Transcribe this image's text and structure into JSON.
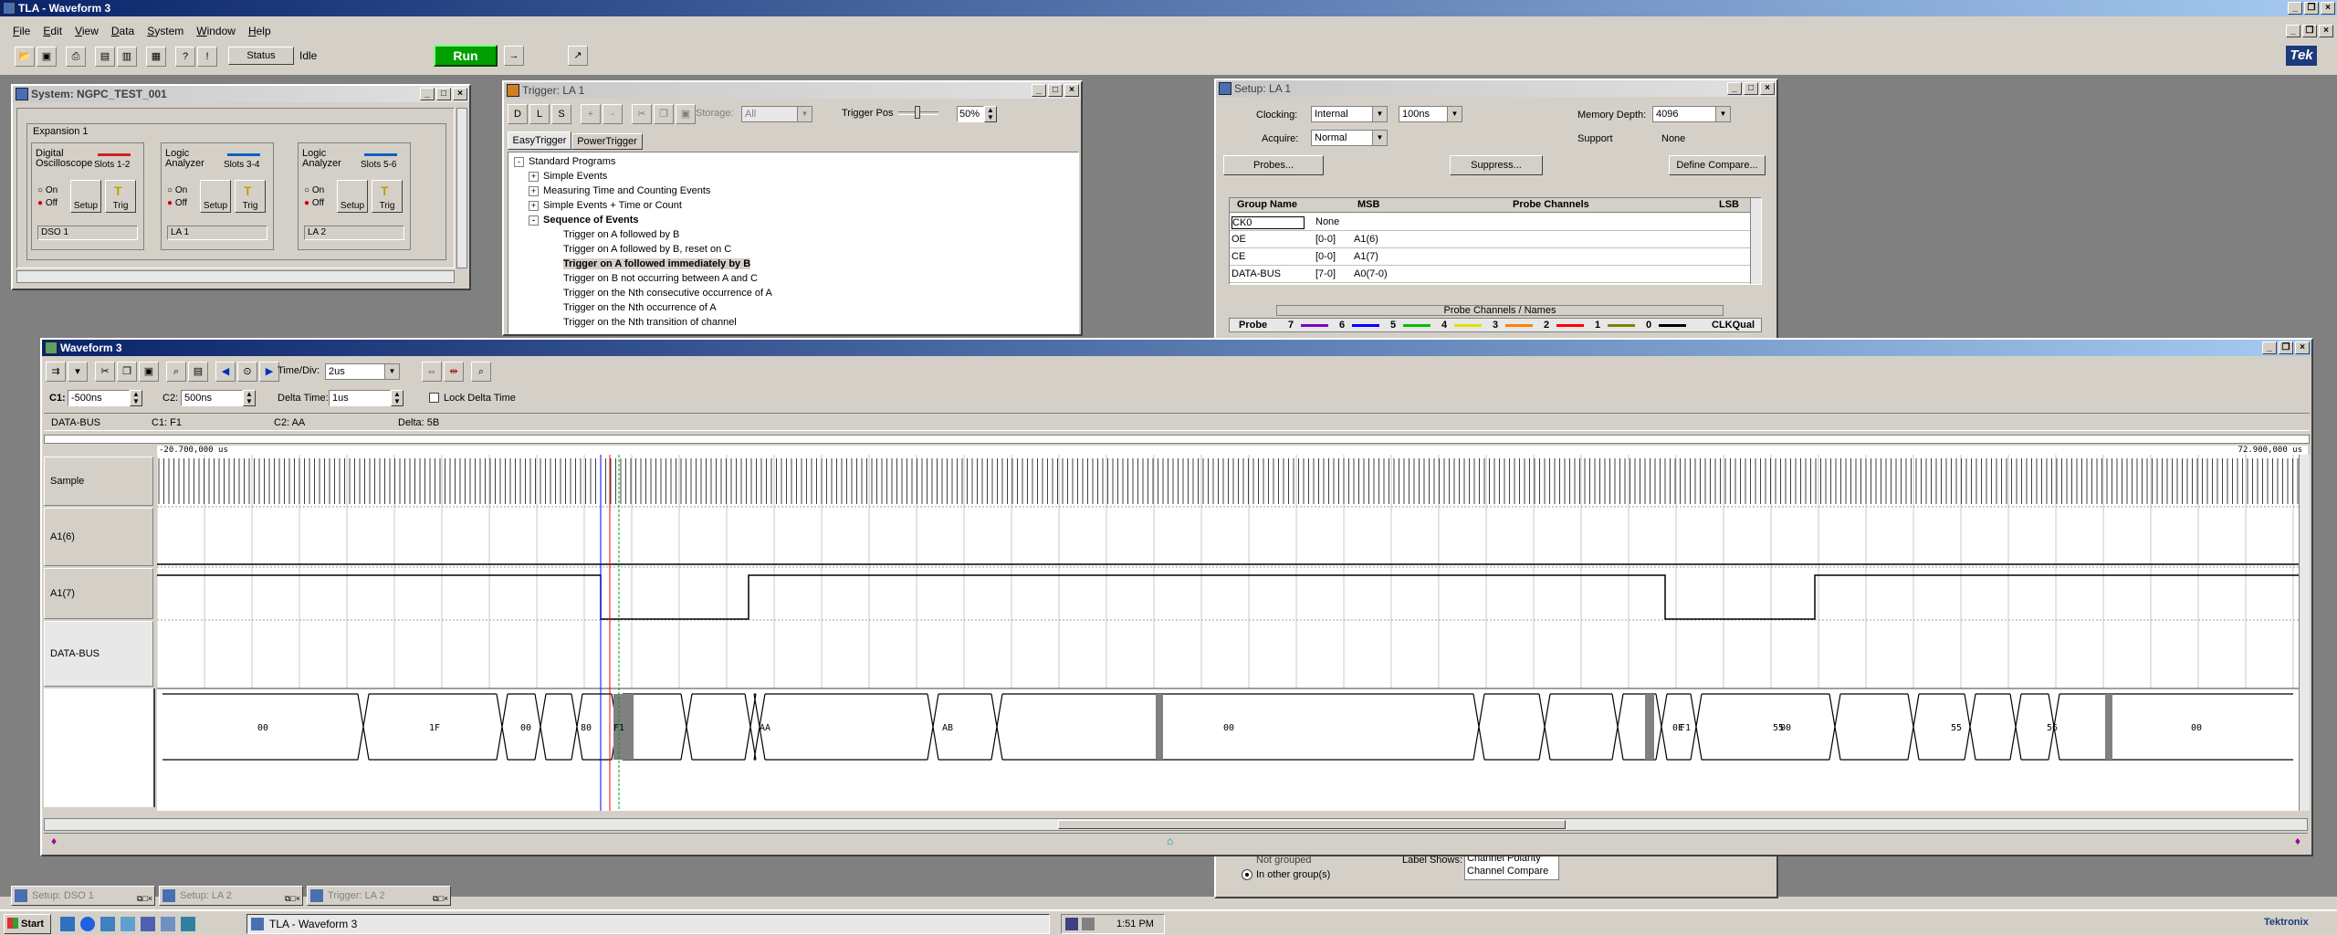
{
  "app": {
    "title": "TLA - Waveform 3",
    "menu": [
      "File",
      "Edit",
      "View",
      "Data",
      "System",
      "Window",
      "Help"
    ],
    "status_label": "Status",
    "status_value": "Idle",
    "run_label": "Run",
    "brand": "Tek"
  },
  "system_window": {
    "title": "System: NGPC_TEST_001",
    "expansion_label": "Expansion 1",
    "modules": [
      {
        "type": "Digital Oscilloscope",
        "slots": "Slots 1-2",
        "on": "On",
        "off": "Off",
        "setup": "Setup",
        "trig": "Trig",
        "name": "DSO 1"
      },
      {
        "type": "Logic Analyzer",
        "slots": "Slots 3-4",
        "on": "On",
        "off": "Off",
        "setup": "Setup",
        "trig": "Trig",
        "name": "LA 1"
      },
      {
        "type": "Logic Analyzer",
        "slots": "Slots 5-6",
        "on": "On",
        "off": "Off",
        "setup": "Setup",
        "trig": "Trig",
        "name": "LA 2"
      }
    ]
  },
  "trigger_window": {
    "title": "Trigger: LA 1",
    "storage_label": "Storage:",
    "storage_value": "All",
    "trigger_pos_label": "Trigger Pos",
    "trigger_pos_value": "50%",
    "tabs": [
      "EasyTrigger",
      "PowerTrigger"
    ],
    "tree": {
      "root": "Standard Programs",
      "groups": [
        "Simple Events",
        "Measuring Time and Counting Events",
        "Simple Events + Time or Count"
      ],
      "open_group": "Sequence of Events",
      "items": [
        "Trigger on A followed by B",
        "Trigger on A followed by B, reset on C",
        "Trigger on A followed immediately by B",
        "Trigger on B not occurring between A and C",
        "Trigger on the Nth consecutive occurrence of A",
        "Trigger on the Nth occurrence of A",
        "Trigger on the Nth transition of channel"
      ]
    }
  },
  "setup_window": {
    "title": "Setup: LA 1",
    "clocking_label": "Clocking:",
    "clocking_value": "Internal",
    "clock_rate": "100ns",
    "memory_depth_label": "Memory Depth:",
    "memory_depth_value": "4096",
    "acquire_label": "Acquire:",
    "acquire_value": "Normal",
    "support_label": "Support",
    "support_value": "None",
    "probes_button": "Probes...",
    "suppress_button": "Suppress...",
    "define_compare_button": "Define Compare...",
    "table_headers": [
      "Group Name",
      "MSB",
      "Probe Channels",
      "LSB"
    ],
    "rows": [
      {
        "name": "CK0",
        "range": "None",
        "channels": ""
      },
      {
        "name": "OE",
        "range": "[0-0]",
        "channels": "A1(6)"
      },
      {
        "name": "CE",
        "range": "[0-0]",
        "channels": "A1(7)"
      },
      {
        "name": "DATA-BUS",
        "range": "[7-0]",
        "channels": "A0(7-0)"
      }
    ],
    "probe_caption": "Probe Channels / Names",
    "probe_label": "Probe",
    "probe_numbers": [
      "7",
      "6",
      "5",
      "4",
      "3",
      "2",
      "1",
      "0"
    ],
    "probe_colors": [
      "#8000c0",
      "#0000ff",
      "#00c000",
      "#e0e000",
      "#ff8000",
      "#ff0000",
      "#808000",
      "#000000"
    ],
    "clkqual": "CLKQual",
    "lower_text": {
      "not_grouped": "Not grouped",
      "in_other_groups": "In other group(s)",
      "label_shows": "Label Shows:",
      "channel_polarity": "Channel Polarity",
      "channel_compare": "Channel Compare"
    }
  },
  "waveform_window": {
    "title": "Waveform 3",
    "time_div_label": "Time/Div:",
    "time_div_value": "2us",
    "c1_label": "C1:",
    "c1_value": "-500ns",
    "c2_label": "C2:",
    "c2_value": "500ns",
    "delta_label": "Delta Time:",
    "delta_value": "1us",
    "lock_label": "Lock Delta Time",
    "readout": {
      "group": "DATA-BUS",
      "c1": "C1: F1",
      "c2": "C2: AA",
      "delta": "Delta: 5B"
    },
    "time_start": "-20.700,000 us",
    "time_end": "72.900,000 us",
    "channels": [
      "Sample",
      "A1(6)",
      "A1(7)",
      "DATA-BUS"
    ],
    "bus_values": [
      "00",
      "1F",
      "00",
      "80",
      "F1",
      "AA",
      "AB",
      "00",
      "0E",
      "00",
      "F1",
      "55",
      "55",
      "56",
      "00"
    ]
  },
  "minimized": [
    {
      "label": "Setup: DSO 1"
    },
    {
      "label": "Setup: LA 2"
    },
    {
      "label": "Trigger: LA 2"
    }
  ],
  "taskbar": {
    "start": "Start",
    "task": "TLA - Waveform 3",
    "clock": "1:51 PM",
    "brand": "Tektronix"
  }
}
